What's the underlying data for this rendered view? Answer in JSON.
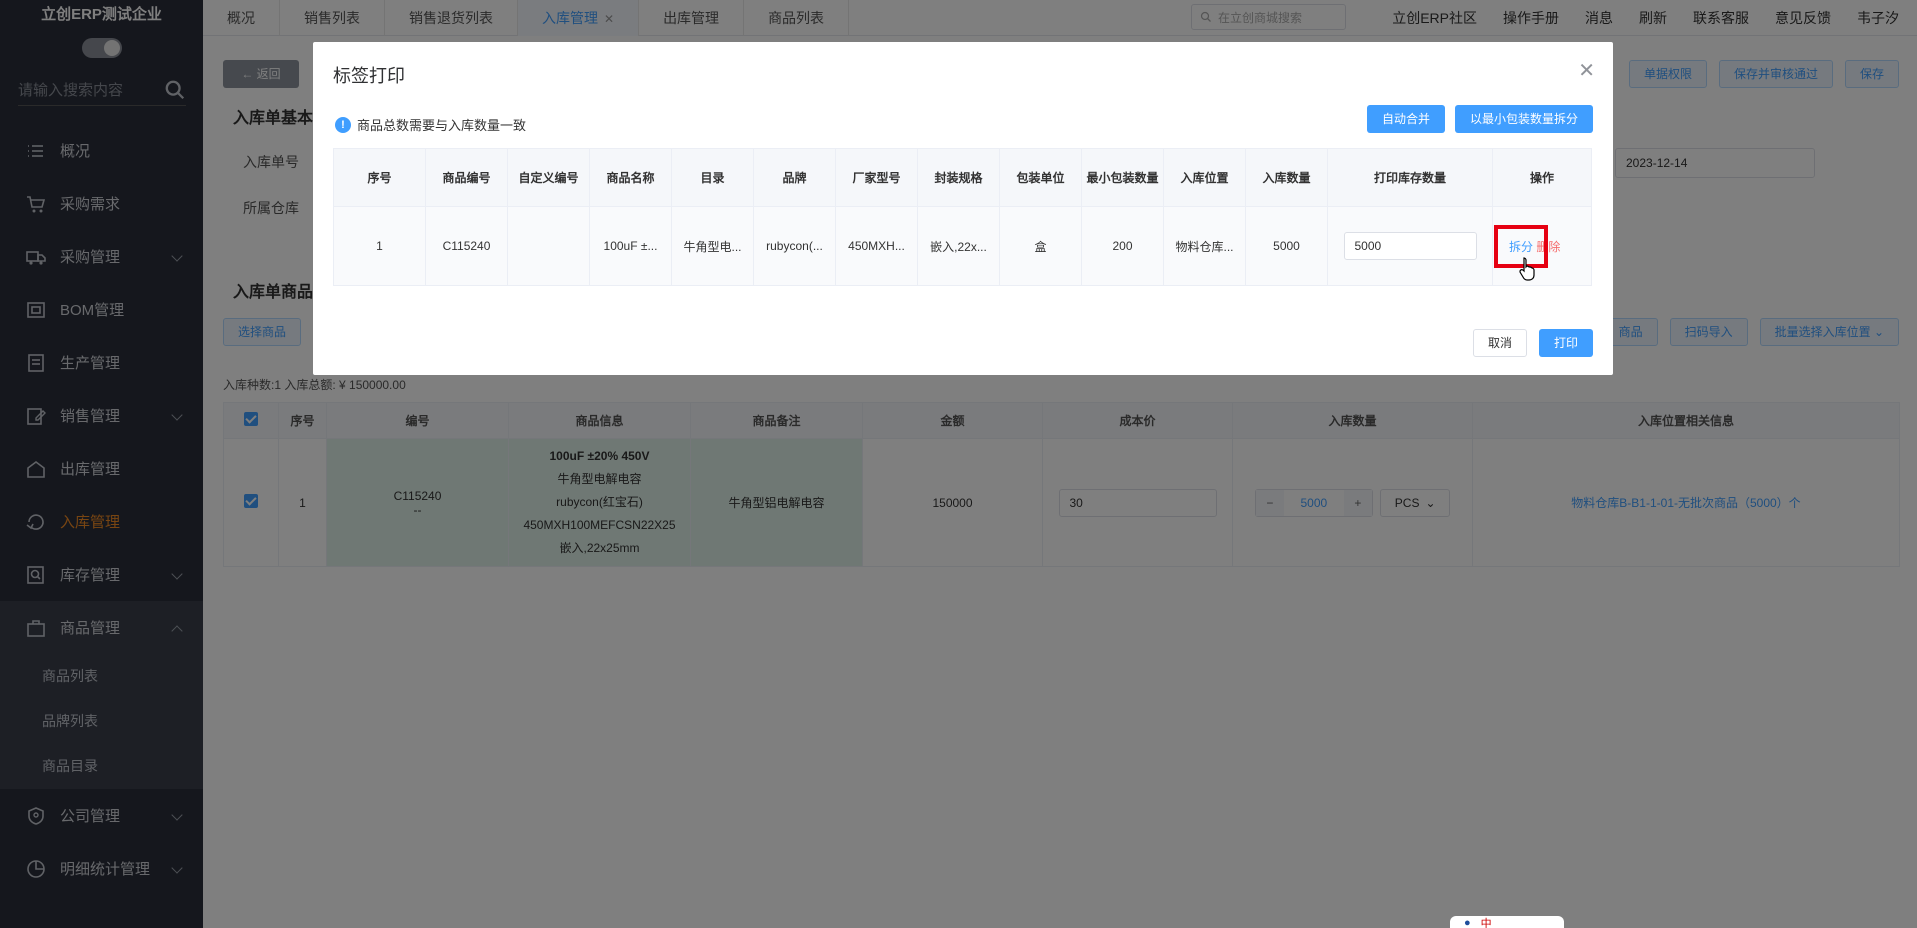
{
  "sidebar": {
    "company": "立创ERP测试企业",
    "search_placeholder": "请输入搜索内容",
    "items": [
      {
        "label": "概况",
        "icon": "list-icon"
      },
      {
        "label": "采购需求",
        "icon": "cart-icon"
      },
      {
        "label": "采购管理",
        "icon": "truck-icon"
      },
      {
        "label": "BOM管理",
        "icon": "box-icon"
      },
      {
        "label": "生产管理",
        "icon": "document-icon"
      },
      {
        "label": "销售管理",
        "icon": "edit-icon"
      },
      {
        "label": "出库管理",
        "icon": "outbound-icon"
      },
      {
        "label": "入库管理",
        "icon": "inbound-icon"
      },
      {
        "label": "库存管理",
        "icon": "search-doc-icon"
      },
      {
        "label": "商品管理",
        "icon": "bag-icon"
      },
      {
        "label": "公司管理",
        "icon": "shield-icon"
      },
      {
        "label": "明细统计管理",
        "icon": "pie-chart-icon"
      }
    ],
    "sub_items": [
      "商品列表",
      "品牌列表",
      "商品目录"
    ]
  },
  "topbar": {
    "tabs": [
      "概况",
      "销售列表",
      "销售退货列表",
      "入库管理",
      "出库管理",
      "商品列表"
    ],
    "active_tab": "入库管理",
    "search_placeholder": "在立创商城搜索",
    "links": [
      "立创ERP社区",
      "操作手册",
      "消息",
      "刷新",
      "联系客服",
      "意见反馈",
      "韦子汐"
    ]
  },
  "page": {
    "back_label": "返回",
    "actions": [
      "单据权限",
      "保存并审核通过",
      "保存"
    ],
    "section_basic": "入库单基本",
    "label_order_no": "入库单号",
    "label_warehouse": "所属仓库",
    "date_value": "2023-12-14",
    "section_goods": "入库单商品",
    "select_goods": "选择商品",
    "right_buttons": [
      "商品",
      "扫码导入",
      "批量选择入库位置"
    ],
    "summary": "入库种数:1   入库总额: ¥ 150000.00",
    "grid_headers": [
      "序号",
      "编号",
      "商品信息",
      "商品备注",
      "金额",
      "成本价",
      "入库数量",
      "入库位置相关信息"
    ],
    "grid_row": {
      "index": "1",
      "code": "C115240",
      "code_sub": "--",
      "info_name": "100uF ±20% 450V",
      "info_lines": [
        "牛角型电解电容",
        "rubycon(红宝石)",
        "450MXH100MEFCSN22X25",
        "嵌入,22x25mm"
      ],
      "remark": "牛角型铝电解电容",
      "amount": "150000",
      "cost": "30",
      "qty": "5000",
      "unit": "PCS",
      "location": "物料仓库B-B1-1-01-无批次商品（5000）个"
    }
  },
  "modal": {
    "title": "标签打印",
    "notice": "商品总数需要与入库数量一致",
    "btn_auto_merge": "自动合并",
    "btn_split_min": "以最小包装数量拆分",
    "headers": [
      "序号",
      "商品编号",
      "自定义编号",
      "商品名称",
      "目录",
      "品牌",
      "厂家型号",
      "封装规格",
      "包装单位",
      "最小包装数量",
      "入库位置",
      "入库数量",
      "打印库存数量",
      "操作"
    ],
    "row": {
      "index": "1",
      "code": "C115240",
      "custom_code": "",
      "name": "100uF ±...",
      "catalog": "牛角型电...",
      "brand": "rubycon(...",
      "model": "450MXH...",
      "package": "嵌入,22x...",
      "unit": "盒",
      "min_pack": "200",
      "location": "物料仓库...",
      "qty": "5000",
      "print_qty": "5000",
      "op_split": "拆分",
      "op_delete": "删除"
    },
    "btn_cancel": "取消",
    "btn_print": "打印"
  },
  "widget": {
    "text": "中"
  }
}
